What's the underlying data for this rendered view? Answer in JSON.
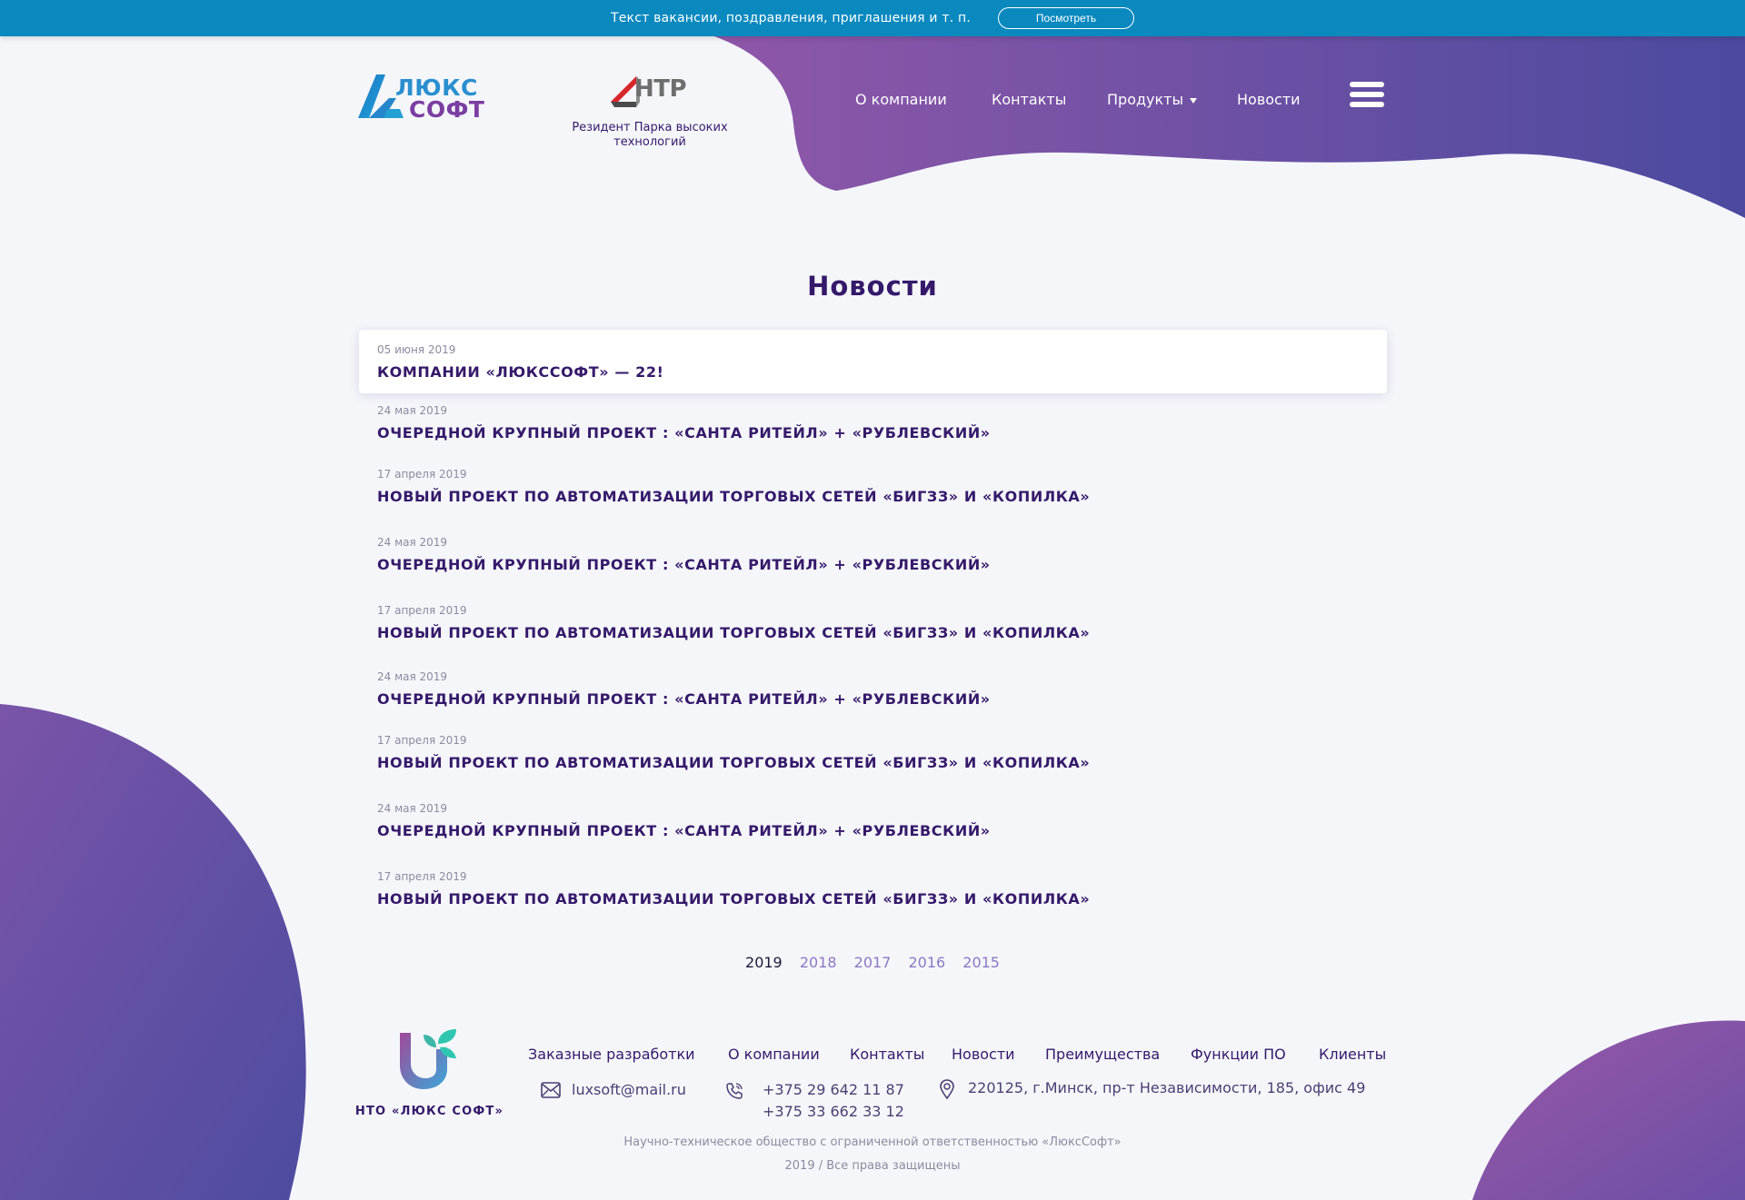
{
  "banner": {
    "text": "Текст вакансии, поздравления, приглашения и т. п.",
    "button_label": "Посмотреть"
  },
  "header": {
    "logo": {
      "line1": "ЛЮКС",
      "line2": "СОФТ"
    },
    "htp": {
      "letters": "НТР",
      "caption": "Резидент Парка высоких технологий"
    },
    "nav": [
      {
        "label": "О компании"
      },
      {
        "label": "Контакты"
      },
      {
        "label": "Продукты"
      },
      {
        "label": "Новости"
      }
    ],
    "menu_icon": "hamburger-menu-icon"
  },
  "main": {
    "title": "Новости",
    "news": [
      {
        "date": "05 июня 2019",
        "title": "КОМПАНИИ «ЛЮКССОФТ» — 22!"
      },
      {
        "date": "24 мая 2019",
        "title": "ОЧЕРЕДНОЙ КРУПНЫЙ ПРОЕКТ : «САНТА РИТЕЙЛ» + «РУБЛЕВСКИЙ»"
      },
      {
        "date": "17 апреля 2019",
        "title": "НОВЫЙ ПРОЕКТ ПО АВТОМАТИЗАЦИИ ТОРГОВЫХ СЕТЕЙ «БИГЗЗ» И «КОПИЛКА»"
      },
      {
        "date": "24 мая 2019",
        "title": "ОЧЕРЕДНОЙ КРУПНЫЙ ПРОЕКТ : «САНТА РИТЕЙЛ» + «РУБЛЕВСКИЙ»"
      },
      {
        "date": "17 апреля 2019",
        "title": "НОВЫЙ ПРОЕКТ ПО АВТОМАТИЗАЦИИ ТОРГОВЫХ СЕТЕЙ «БИГЗЗ» И «КОПИЛКА»"
      },
      {
        "date": "24 мая 2019",
        "title": "ОЧЕРЕДНОЙ КРУПНЫЙ ПРОЕКТ : «САНТА РИТЕЙЛ» + «РУБЛЕВСКИЙ»"
      },
      {
        "date": "17 апреля 2019",
        "title": "НОВЫЙ ПРОЕКТ ПО АВТОМАТИЗАЦИИ ТОРГОВЫХ СЕТЕЙ «БИГЗЗ» И «КОПИЛКА»"
      },
      {
        "date": "24 мая 2019",
        "title": "ОЧЕРЕДНОЙ КРУПНЫЙ ПРОЕКТ : «САНТА РИТЕЙЛ» + «РУБЛЕВСКИЙ»"
      },
      {
        "date": "17 апреля 2019",
        "title": "НОВЫЙ ПРОЕКТ ПО АВТОМАТИЗАЦИИ ТОРГОВЫХ СЕТЕЙ «БИГЗЗ» И «КОПИЛКА»"
      }
    ],
    "years": [
      "2019",
      "2018",
      "2017",
      "2016",
      "2015"
    ],
    "active_year": "2019"
  },
  "footer": {
    "brand": "НТО «ЛЮКС СОФТ»",
    "links": [
      "Заказные разработки",
      "О компании",
      "Контакты",
      "Новости",
      "Преимущества",
      "Функции ПО",
      "Клиенты"
    ],
    "email": "luxsoft@mail.ru",
    "phones": [
      "+375 29 642 11 87",
      "+375 33 662 33 12"
    ],
    "address": "220125, г.Минск, пр-т Независимости, 185, офис 49",
    "legal": "Научно-техническое общество с ограниченной ответственностью «ЛюксСофт»",
    "copyright": "2019 / Все права защищены"
  },
  "colors": {
    "banner": "#0a89bf",
    "brand_purple": "#35196a",
    "gradient_start": "#8e56a8",
    "gradient_end": "#4a48a0",
    "year_link": "#8b78c3"
  }
}
